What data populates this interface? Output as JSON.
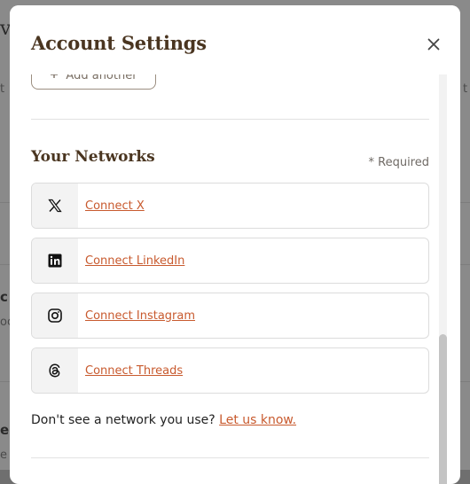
{
  "background": {
    "frag_top_left": "vc",
    "frag_left_1": "t",
    "frag_right_1": "t",
    "frag_left_2": "c",
    "frag_left_3": "oc",
    "frag_left_4": "er",
    "frag_left_5": "e"
  },
  "modal": {
    "title": "Account Settings",
    "close_icon": "close-icon"
  },
  "add_another": {
    "icon": "plus-icon",
    "label": "Add another"
  },
  "networks": {
    "title": "Your Networks",
    "required_note": "* Required",
    "items": [
      {
        "icon": "x-logo-icon",
        "label": "Connect X"
      },
      {
        "icon": "linkedin-logo-icon",
        "label": "Connect LinkedIn"
      },
      {
        "icon": "instagram-logo-icon",
        "label": "Connect Instagram"
      },
      {
        "icon": "threads-logo-icon",
        "label": "Connect Threads"
      }
    ],
    "footnote_text": "Don't see a network you use? ",
    "footnote_link": "Let us know."
  },
  "colors": {
    "accent": "#c85a2e",
    "heading": "#4a3520"
  }
}
